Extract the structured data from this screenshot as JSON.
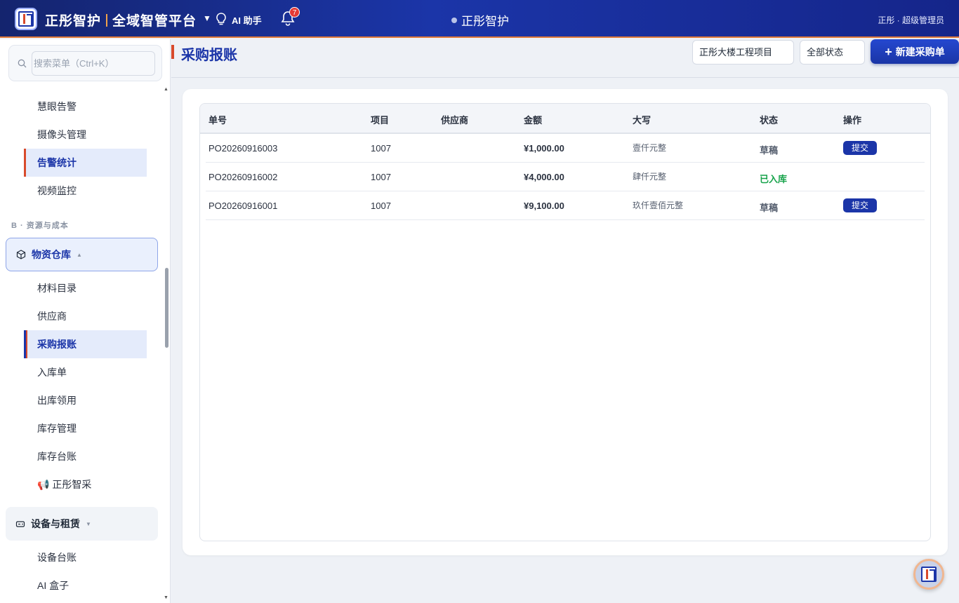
{
  "header": {
    "brand_name": "正彤智护",
    "platform_name": "全域智管平台",
    "dropdown_caret": "▼",
    "ai_assistant_label": "AI 助手",
    "notification_count": "7",
    "center_title": "正彤智护",
    "user_label": "正彤 · 超级管理员"
  },
  "sidebar": {
    "search_placeholder": "搜索菜单（Ctrl+K）",
    "items_top": [
      {
        "label": "慧眼告警"
      },
      {
        "label": "摄像头管理"
      },
      {
        "label": "告警统计"
      },
      {
        "label": "视频监控"
      }
    ],
    "section_label": "B · 资源与成本",
    "group_warehouse": {
      "label": "物资仓库",
      "arrow": "▲"
    },
    "warehouse_items": [
      {
        "label": "材料目录"
      },
      {
        "label": "供应商"
      },
      {
        "label": "采购报账"
      },
      {
        "label": "入库单"
      },
      {
        "label": "出库领用"
      },
      {
        "label": "库存管理"
      },
      {
        "label": "库存台账"
      },
      {
        "label": "📢 正彤智采"
      }
    ],
    "group_equipment": {
      "label": "设备与租赁",
      "arrow": "▼"
    },
    "equipment_items": [
      {
        "label": "设备台账"
      },
      {
        "label": "AI 盒子"
      }
    ]
  },
  "page": {
    "title": "采购报账",
    "project_select": "正彤大楼工程项目",
    "status_select": "全部状态",
    "new_button_plus": "+",
    "new_button_label": "新建采购单"
  },
  "table": {
    "columns": [
      "单号",
      "项目",
      "供应商",
      "金额",
      "大写",
      "状态",
      "操作"
    ],
    "rows": [
      {
        "no": "PO20260916003",
        "project": "1007",
        "supplier": "",
        "amount": "¥1,000.00",
        "amount_cn": "壹仟元整",
        "status": "草稿",
        "action": "提交"
      },
      {
        "no": "PO20260916002",
        "project": "1007",
        "supplier": "",
        "amount": "¥4,000.00",
        "amount_cn": "肆仟元整",
        "status": "已入库",
        "action": ""
      },
      {
        "no": "PO20260916001",
        "project": "1007",
        "supplier": "",
        "amount": "¥9,100.00",
        "amount_cn": "玖仟壹佰元整",
        "status": "草稿",
        "action": "提交"
      }
    ]
  },
  "colors": {
    "brand_blue": "#1b35a8",
    "accent_orange": "#d84a2b",
    "success_green": "#16a34a",
    "badge_red": "#e53935"
  }
}
